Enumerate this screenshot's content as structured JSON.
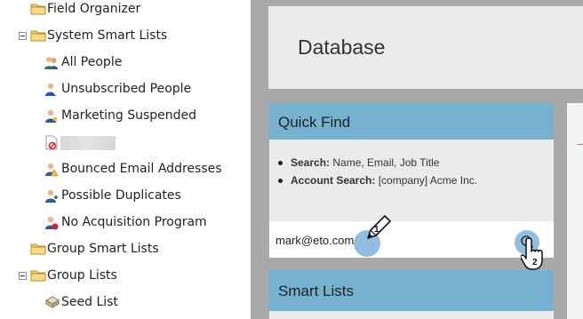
{
  "tree": {
    "items": [
      {
        "label": "Field Organizer",
        "icon": "folder-icon"
      },
      {
        "label": "System Smart Lists",
        "icon": "folder-icon",
        "expanded": true
      },
      {
        "label": "All People",
        "icon": "people-group-icon"
      },
      {
        "label": "Unsubscribed People",
        "icon": "person-unsubscribed-icon"
      },
      {
        "label": "Marketing Suspended",
        "icon": "person-suspended-icon"
      },
      {
        "label": "",
        "icon": "blocked-document-icon",
        "redacted": true
      },
      {
        "label": "Bounced Email Addresses",
        "icon": "person-warning-icon"
      },
      {
        "label": "Possible Duplicates",
        "icon": "person-duplicate-icon"
      },
      {
        "label": "No Acquisition Program",
        "icon": "person-no-program-icon"
      },
      {
        "label": "Group Smart Lists",
        "icon": "folder-icon"
      },
      {
        "label": "Group Lists",
        "icon": "folder-icon",
        "expanded": true
      },
      {
        "label": "Seed List",
        "icon": "seed-list-icon"
      }
    ]
  },
  "header": {
    "title": "Database"
  },
  "quick_find": {
    "title": "Quick Find",
    "tips": [
      {
        "key": "Search:",
        "text": " Name, Email, Job Title"
      },
      {
        "key": "Account Search:",
        "text": " [company] Acme Inc."
      }
    ],
    "search_value": "mark@eto.com",
    "step_badges": [
      "1",
      "2"
    ]
  },
  "smart_lists": {
    "title": "Smart Lists"
  },
  "colors": {
    "panel_header": "#75b2cf",
    "panel_bg": "#ebebed",
    "workspace_bg": "#a9a9a9",
    "highlight": "#6eaad7"
  }
}
